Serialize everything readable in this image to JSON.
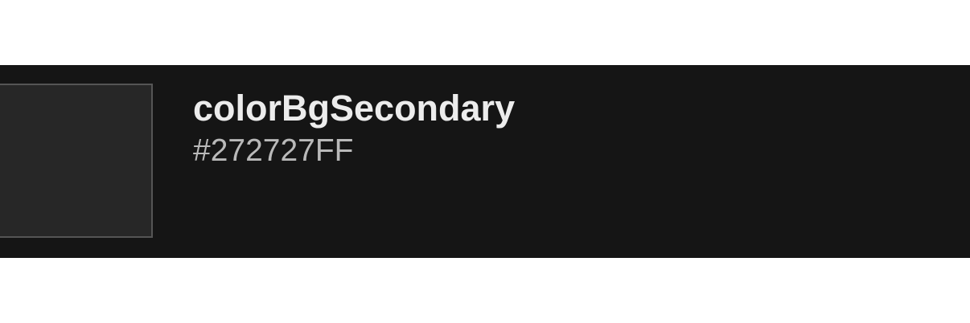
{
  "token": {
    "name": "colorBgSecondary",
    "value": "#272727FF",
    "swatch_color": "#272727",
    "swatch_border_color": "#555555",
    "row_background": "#151515"
  }
}
